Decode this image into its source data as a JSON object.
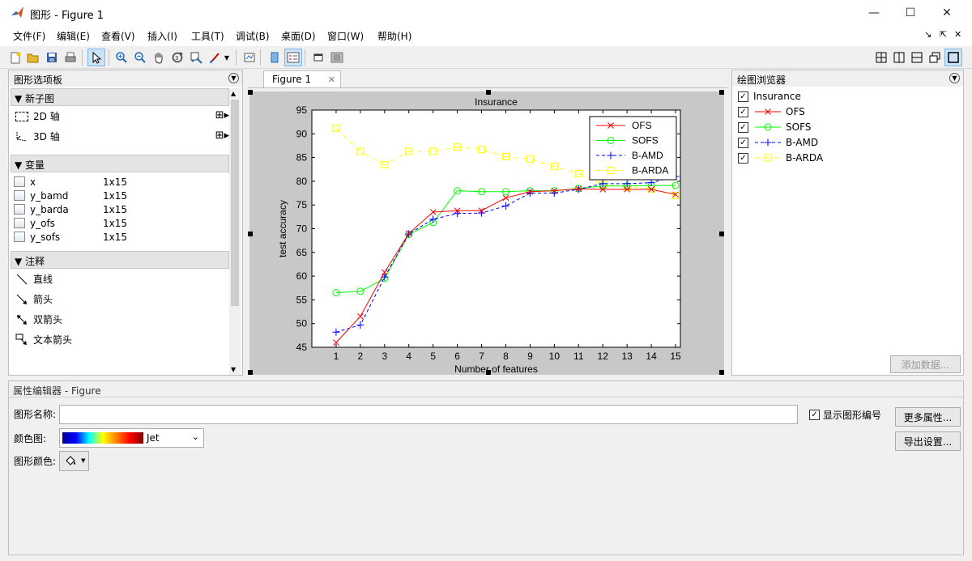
{
  "window": {
    "title": "图形 - Figure 1",
    "minimize": "—",
    "maximize": "☐",
    "close": "✕"
  },
  "menu": [
    "文件(F)",
    "编辑(E)",
    "查看(V)",
    "插入(I)",
    "工具(T)",
    "调试(B)",
    "桌面(D)",
    "窗口(W)",
    "帮助(H)"
  ],
  "menu_right": [
    "↘",
    "⇱",
    "✕"
  ],
  "palette": {
    "title": "图形选项板",
    "sections": {
      "new_subplot": "新子图",
      "variables": "变量",
      "annotations": "注释"
    },
    "axes_items": [
      "2D 轴",
      "3D 轴"
    ],
    "variables": [
      {
        "name": "x",
        "size": "1x15"
      },
      {
        "name": "y_bamd",
        "size": "1x15"
      },
      {
        "name": "y_barda",
        "size": "1x15"
      },
      {
        "name": "y_ofs",
        "size": "1x15"
      },
      {
        "name": "y_sofs",
        "size": "1x15"
      }
    ],
    "annotations": [
      "直线",
      "箭头",
      "双箭头",
      "文本箭头"
    ]
  },
  "figure_tab": {
    "label": "Figure 1",
    "close": "✕"
  },
  "plot_browser": {
    "title": "绘图浏览器",
    "root": "Insurance",
    "items": [
      "OFS",
      "SOFS",
      "B-AMD",
      "B-ARDA"
    ],
    "add_data": "添加数据..."
  },
  "property_editor": {
    "title": "属性编辑器 - Figure",
    "name_label": "图形名称:",
    "name_value": "",
    "colormap_label": "颜色图:",
    "colormap_value": "Jet",
    "color_label": "图形颜色:",
    "show_number_label": "显示图形编号",
    "more_props": "更多属性...",
    "export_settings": "导出设置..."
  },
  "colors": {
    "ofs": "#ff0000",
    "sofs": "#00ff00",
    "bamd": "#0000ff",
    "barda": "#ffff00",
    "canvas": "#c8c8c8"
  },
  "chart_data": {
    "type": "line",
    "title": "Insurance",
    "xlabel": "Number of features",
    "ylabel": "test accuracy",
    "x": [
      1,
      2,
      3,
      4,
      5,
      6,
      7,
      8,
      9,
      10,
      11,
      12,
      13,
      14,
      15
    ],
    "xlim": [
      0,
      15
    ],
    "ylim": [
      45,
      95
    ],
    "yticks": [
      45,
      50,
      55,
      60,
      65,
      70,
      75,
      80,
      85,
      90,
      95
    ],
    "legend_position": "top-right",
    "grid": false,
    "series": [
      {
        "name": "OFS",
        "color": "#ff0000",
        "marker": "x",
        "dash": "solid",
        "values": [
          46.0,
          51.5,
          60.8,
          69.0,
          73.5,
          73.8,
          73.8,
          76.5,
          77.8,
          78.0,
          78.4,
          78.3,
          78.3,
          78.3,
          77.2
        ]
      },
      {
        "name": "SOFS",
        "color": "#00ff00",
        "marker": "circle",
        "dash": "solid",
        "values": [
          56.5,
          56.8,
          59.5,
          68.8,
          71.3,
          78.0,
          77.8,
          77.8,
          78.0,
          78.0,
          78.5,
          79.0,
          79.0,
          79.1,
          79.1
        ]
      },
      {
        "name": "B-AMD",
        "color": "#0000ff",
        "marker": "plus",
        "dash": "dashed",
        "values": [
          48.2,
          49.7,
          59.8,
          68.9,
          72.0,
          73.2,
          73.3,
          74.8,
          77.5,
          77.5,
          78.3,
          79.5,
          79.5,
          79.7,
          81.0
        ]
      },
      {
        "name": "B-ARDA",
        "color": "#ffff00",
        "marker": "square",
        "dash": "dashdot",
        "values": [
          91.2,
          86.3,
          83.5,
          86.3,
          86.3,
          87.2,
          86.7,
          85.2,
          84.7,
          83.1,
          81.6,
          79.3,
          78.8,
          78.4,
          77.0
        ]
      }
    ]
  }
}
